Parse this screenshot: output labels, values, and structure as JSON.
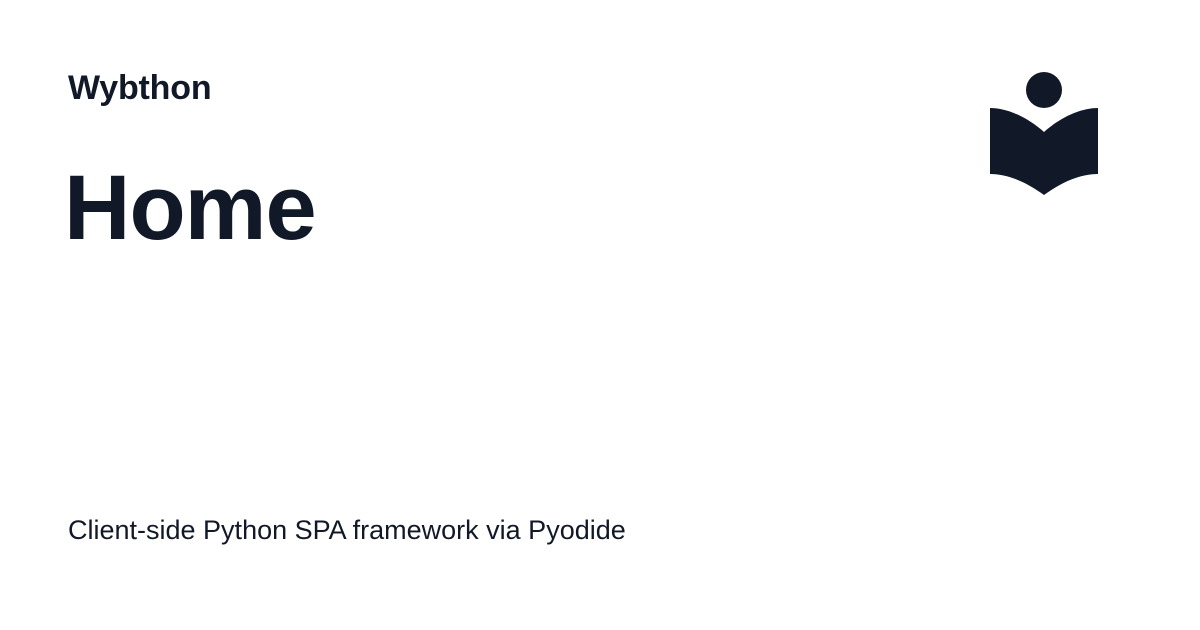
{
  "site": {
    "name": "Wybthon"
  },
  "page": {
    "title": "Home",
    "description": "Client-side Python SPA framework via Pyodide"
  },
  "logo": {
    "icon": "book-reader-icon",
    "color": "#111827"
  },
  "colors": {
    "text": "#111827",
    "background": "#ffffff"
  }
}
